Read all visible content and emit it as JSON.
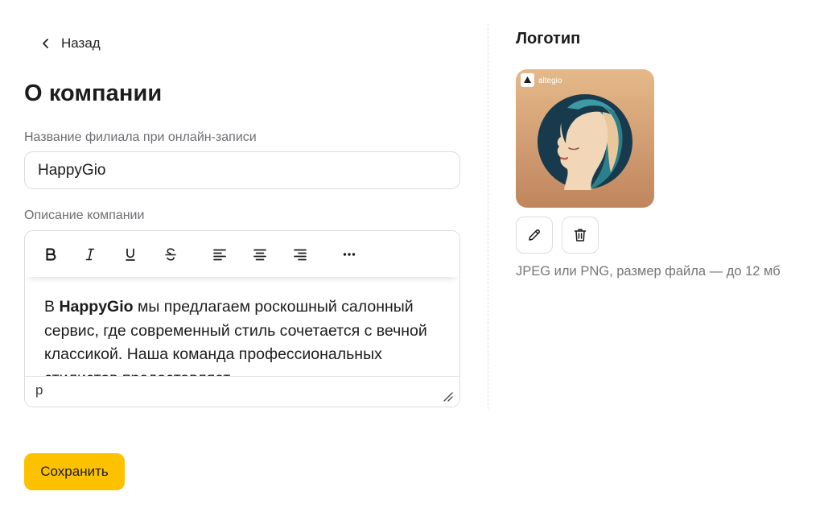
{
  "header": {
    "back_label": "Назад",
    "page_title": "О компании"
  },
  "branch_name": {
    "label": "Название филиала при онлайн-записи",
    "value": "HappyGio"
  },
  "description": {
    "label": "Описание компании",
    "toolbar": [
      "bold-icon",
      "italic-icon",
      "underline-icon",
      "strikethrough-icon",
      "align-left-icon",
      "align-center-icon",
      "align-right-icon",
      "more-icon"
    ],
    "text_prefix": "В ",
    "text_bold": "HappyGio",
    "text_rest": " мы предлагаем роскошный салонный сервис, где современный стиль сочетается с вечной классикой. Наша команда профессиональных стилистов предоставляет",
    "status_path": "p"
  },
  "logo": {
    "title": "Логотип",
    "brand_text": "altegio",
    "hint": "JPEG или PNG, размер файла — до 12 мб"
  },
  "actions": {
    "save_label": "Сохранить"
  },
  "colors": {
    "accent": "#fcc200",
    "border": "#dcdce0",
    "muted_text": "#6e6e73"
  }
}
